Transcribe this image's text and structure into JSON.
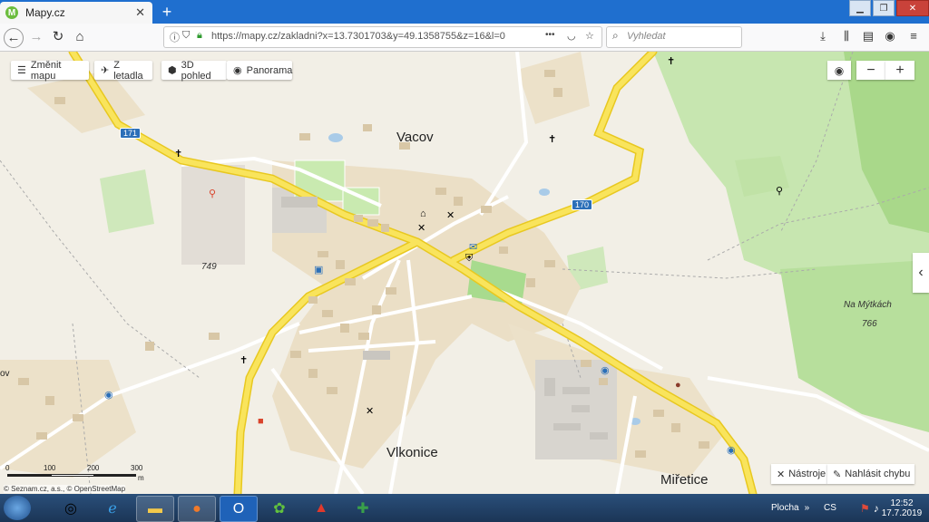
{
  "browser": {
    "tab_title": "Mapy.cz",
    "tab_favicon": "M",
    "tab_close": "✕",
    "new_tab": "+",
    "url": "https://mapy.cz/zakladni?x=13.7301703&y=49.1358755&z=16&l=0",
    "url_domain": "mapy.cz",
    "search_placeholder": "Vyhledat",
    "more": "•••"
  },
  "map_controls": {
    "change_map": "Změnit mapu",
    "from_plane": "Z letadla",
    "view_3d": "3D pohled",
    "panorama": "Panorama",
    "zoom_out": "−",
    "zoom_in": "+",
    "tools": "Nástroje",
    "report_error": "Nahlásit chybu",
    "side_toggle": "‹"
  },
  "places": {
    "vacov": "Vacov",
    "vlkonice": "Vlkonice",
    "miretice": "Miřetice",
    "left_cut": "ov"
  },
  "peaks": {
    "p749": "749",
    "na_mytkach": "Na Mýtkách",
    "p766": "766"
  },
  "routes": {
    "r171": "171",
    "r170": "170"
  },
  "scale": {
    "labels": [
      "0",
      "100",
      "200",
      "300"
    ],
    "unit": "m"
  },
  "attribution": "© Seznam.cz, a.s., © OpenStreetMap",
  "taskbar": {
    "desktop": "Plocha",
    "chevron": "»",
    "lang": "CS",
    "time": "12:52",
    "date": "17.7.2019"
  }
}
